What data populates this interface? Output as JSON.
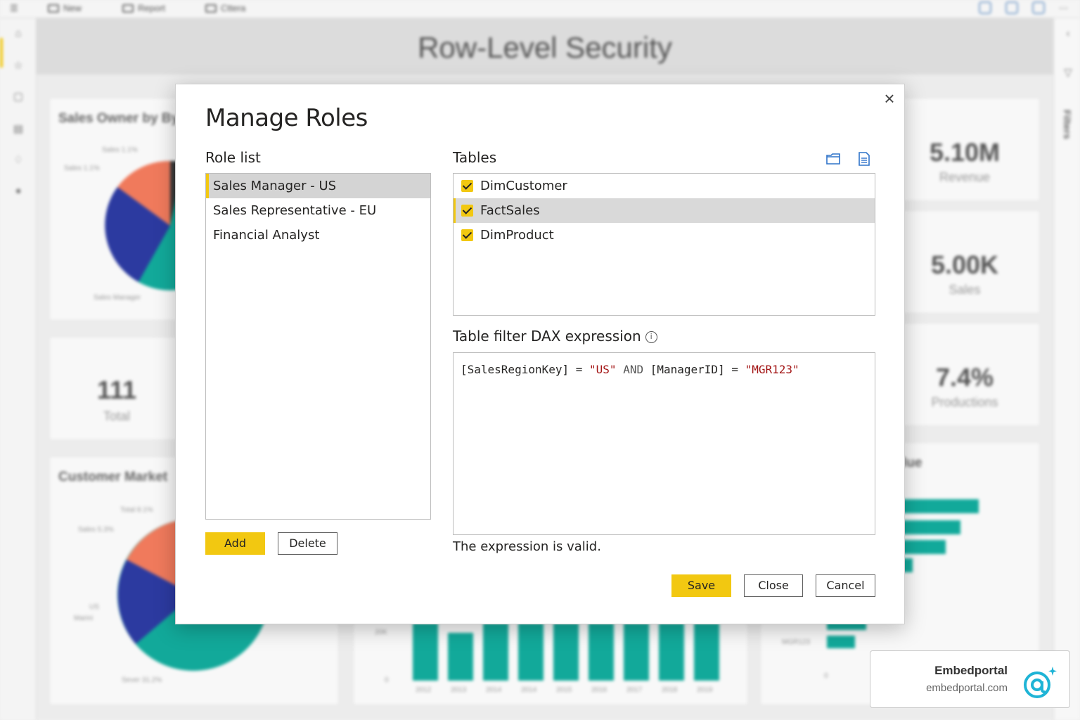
{
  "report": {
    "title": "Row-Level Security",
    "toolbar": {
      "new_label": "New",
      "report_label": "Report",
      "share_label": "Cttera"
    },
    "filters_label": "Filters",
    "cards": {
      "sales_owner_title": "Sales Owner by By",
      "customer_market_title": "Customer Market",
      "value_title": "lue",
      "total_value": "111",
      "total_label": "Total",
      "revenue_value": "5.10M",
      "revenue_label": "Revenue",
      "sales_value": "5.00K",
      "sales_label": "Sales",
      "productions_value": "7.4%",
      "productions_label": "Productions"
    },
    "pie_labels": {
      "a": "Sales 1.1%",
      "b": "Sales 1.1%",
      "c": "Sales Manager",
      "d": "Total 8.1%",
      "e": "Sales 5.3%",
      "f": "US",
      "g": "Marini",
      "h": "Sever 31.2%"
    },
    "bar_axis": {
      "y_ticks": [
        "20K",
        "0"
      ],
      "x_ticks": [
        "2012",
        "2013",
        "2014",
        "2014",
        "2015",
        "2016",
        "2017",
        "2018",
        "2019"
      ]
    },
    "hbar_labels": {
      "last": "MGR123",
      "zero": "0"
    }
  },
  "modal": {
    "title": "Manage Roles",
    "role_list_label": "Role list",
    "roles": [
      {
        "label": "Sales Manager - US",
        "selected": true
      },
      {
        "label": "Sales Representative - EU",
        "selected": false
      },
      {
        "label": "Financial Analyst",
        "selected": false
      }
    ],
    "add_label": "Add",
    "delete_label": "Delete",
    "tables_label": "Tables",
    "tables": [
      {
        "label": "DimCustomer",
        "checked": true,
        "selected": false
      },
      {
        "label": "FactSales",
        "checked": true,
        "selected": true
      },
      {
        "label": "DimProduct",
        "checked": true,
        "selected": false
      }
    ],
    "dax_label": "Table filter DAX expression",
    "dax": {
      "part1": "[SalesRegionKey] = ",
      "str1": "\"US\"",
      "kw": " AND ",
      "part2": "[ManagerID] = ",
      "str2": "\"MGR123\""
    },
    "valid_message": "The expression is valid.",
    "save_label": "Save",
    "close_label": "Close",
    "cancel_label": "Cancel"
  },
  "watermark": {
    "name": "Embedportal",
    "url": "embedportal.com"
  },
  "colors": {
    "accent": "#f2c811",
    "teal": "#12a99a",
    "navy": "#2c3aa0",
    "salmon": "#f07a5c",
    "dark": "#3a3a3a"
  }
}
